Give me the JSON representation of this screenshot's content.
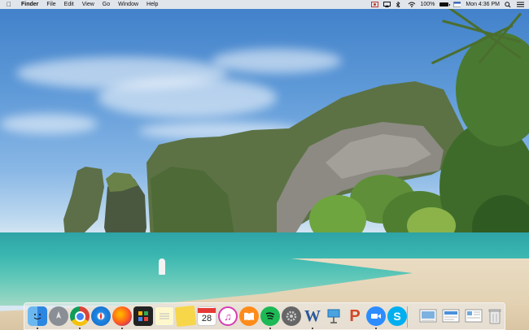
{
  "menubar": {
    "apple": "",
    "app_name": "Finder",
    "menus": [
      "File",
      "Edit",
      "View",
      "Go",
      "Window",
      "Help"
    ],
    "battery": "100%",
    "clock": "Mon 4:36 PM"
  },
  "dock": {
    "calendar_day": "28",
    "apps": [
      "finder-icon",
      "launchpad-icon",
      "chrome-icon",
      "safari-icon",
      "firefox-icon",
      "tableplus-icon",
      "notes-icon",
      "stickies-icon",
      "calendar-icon",
      "itunes-icon",
      "books-icon",
      "spotify-icon",
      "system-preferences-icon",
      "word-icon",
      "keynote-icon",
      "powerpoint-icon",
      "zoom-icon",
      "skype-icon",
      "preview-icon",
      "screenshot-icon",
      "document-icon",
      "trash-icon"
    ]
  },
  "colors": {
    "menubar": "#eeeeee",
    "dock": "#eeeeee",
    "sky": "#5f9ad8",
    "sea": "#39b6b0",
    "sand": "#e3d2b3"
  }
}
